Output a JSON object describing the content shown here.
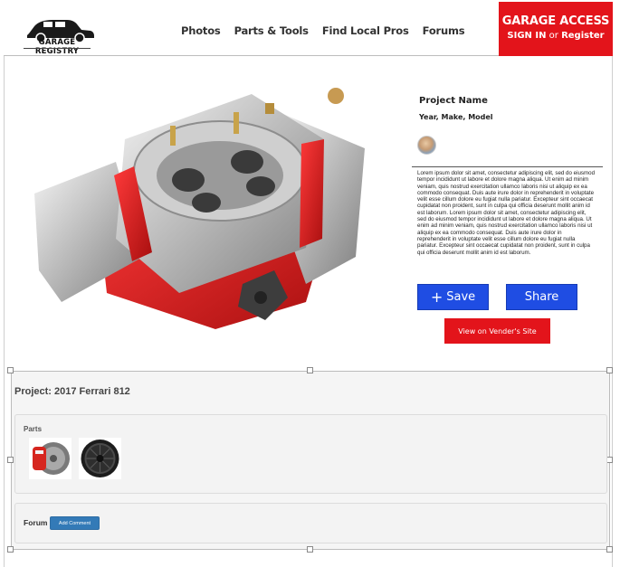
{
  "header": {
    "logo_text": "GARAGE REGISTRY",
    "nav": [
      "Photos",
      "Parts & Tools",
      "Find Local Pros",
      "Forums"
    ],
    "access_title": "GARAGE ACCESS",
    "sign_in": "SIGN IN",
    "or": "or",
    "register": "Register"
  },
  "product": {
    "image": "carburetor-photo"
  },
  "info": {
    "project_name": "Project Name",
    "year_make_model": "Year, Make, Model",
    "description": "Lorem ipsum dolor sit amet, consectetur adipiscing elit, sed do eiusmod tempor incididunt ut labore et dolore magna aliqua. Ut enim ad minim veniam, quis nostrud exercitation ullamco laboris nisi ut aliquip ex ea commodo consequat. Duis aute irure dolor in reprehenderit in voluptate velit esse cillum dolore eu fugiat nulla pariatur. Excepteur sint occaecat cupidatat non proident, sunt in culpa qui officia deserunt mollit anim id est laborum.  Lorem ipsum dolor sit amet, consectetur adipiscing elit, sed do eiusmod tempor incididunt ut labore et dolore magna aliqua. Ut enim ad minim veniam, quis nostrud exercitation ullamco laboris nisi ut aliquip ex ea commodo consequat. Duis aute irure dolor in reprehenderit in voluptate velit esse cillum dolore eu fugiat nulla pariatur. Excepteur sint occaecat cupidatat non proident, sunt in culpa qui officia deserunt mollit anim id est laborum.",
    "save_label": "Save",
    "share_label": "Share",
    "vendor_label": "View on Vender's Site"
  },
  "project": {
    "title": "Project: 2017 Ferrari 812",
    "parts_label": "Parts",
    "forum_label": "Forum",
    "add_comment_label": "Add Comment"
  },
  "colors": {
    "brand_red": "#e3141b",
    "action_blue": "#1f4de3",
    "bootstrap_blue": "#337ab7"
  }
}
